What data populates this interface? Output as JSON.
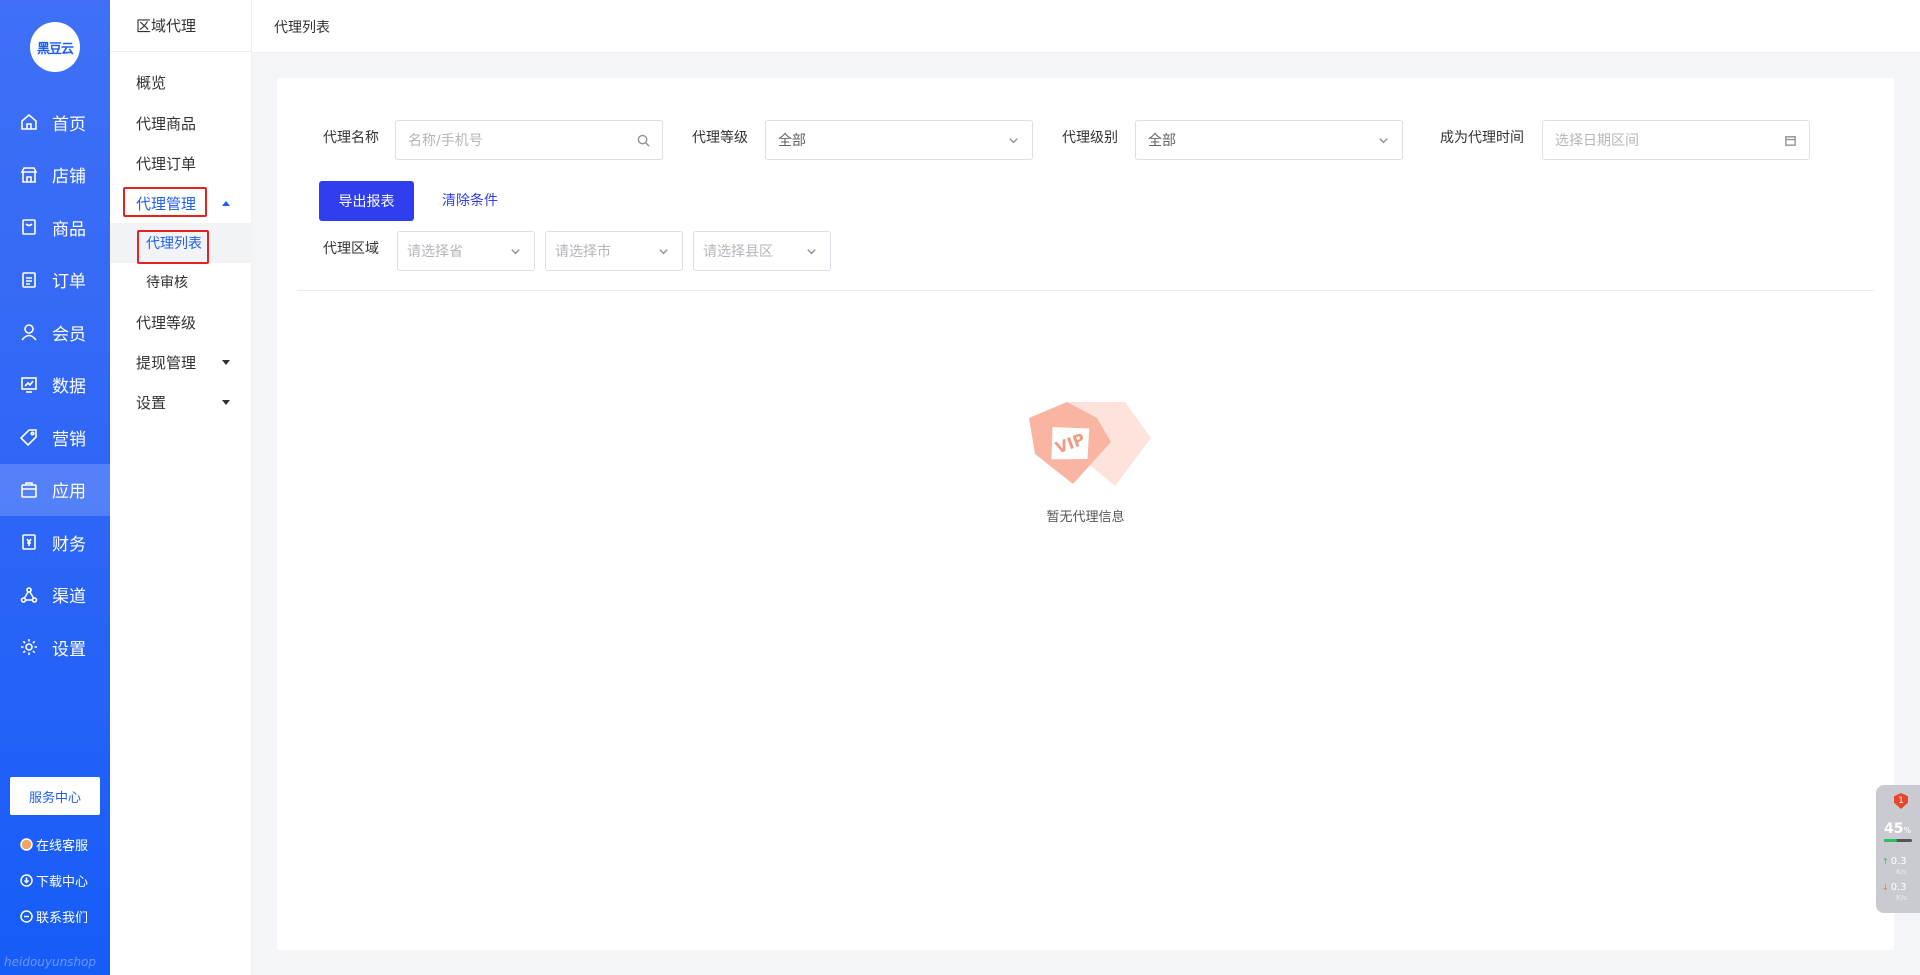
{
  "logo": {
    "text": "黑豆云"
  },
  "primary_nav": [
    {
      "label": "首页",
      "icon": "home-icon"
    },
    {
      "label": "店铺",
      "icon": "store-icon"
    },
    {
      "label": "商品",
      "icon": "goods-icon"
    },
    {
      "label": "订单",
      "icon": "order-icon"
    },
    {
      "label": "会员",
      "icon": "member-icon"
    },
    {
      "label": "数据",
      "icon": "data-icon"
    },
    {
      "label": "营销",
      "icon": "tag-icon"
    },
    {
      "label": "应用",
      "icon": "app-icon",
      "active": true
    },
    {
      "label": "财务",
      "icon": "finance-icon"
    },
    {
      "label": "渠道",
      "icon": "channel-icon"
    },
    {
      "label": "设置",
      "icon": "settings-icon"
    }
  ],
  "service_center": "服务中心",
  "side_links": {
    "online_service": "在线客服",
    "download_center": "下载中心",
    "contact_us": "联系我们"
  },
  "watermark": "heidouyunshop",
  "secondary_nav": {
    "title": "区域代理",
    "items": [
      {
        "label": "概览"
      },
      {
        "label": "代理商品"
      },
      {
        "label": "代理订单"
      },
      {
        "label": "代理管理",
        "expanded": true
      },
      {
        "label": "代理列表",
        "sub": true,
        "active": true
      },
      {
        "label": "待审核",
        "sub": true
      },
      {
        "label": "代理等级"
      },
      {
        "label": "提现管理"
      },
      {
        "label": "设置"
      }
    ]
  },
  "breadcrumb": "代理列表",
  "filters": {
    "name_label": "代理名称",
    "name_placeholder": "名称/手机号",
    "level_label": "代理等级",
    "level_value": "全部",
    "rank_label": "代理级别",
    "rank_value": "全部",
    "time_label": "成为代理时间",
    "time_placeholder": "选择日期区间",
    "region_label": "代理区域",
    "province_placeholder": "请选择省",
    "city_placeholder": "请选择市",
    "district_placeholder": "请选择县区"
  },
  "actions": {
    "export": "导出报表",
    "clear": "清除条件"
  },
  "empty": {
    "text": "暂无代理信息",
    "badge_text": "VIP"
  },
  "widget": {
    "badge": "1",
    "percent": "45",
    "percent_unit": "%",
    "upload": "0.3",
    "download": "0.3",
    "unit": "K/s",
    "bar_fill": 0.45
  },
  "colors": {
    "sidebar": "#2f66f7",
    "primary": "#2f3ff0",
    "highlight": "#e52222"
  }
}
